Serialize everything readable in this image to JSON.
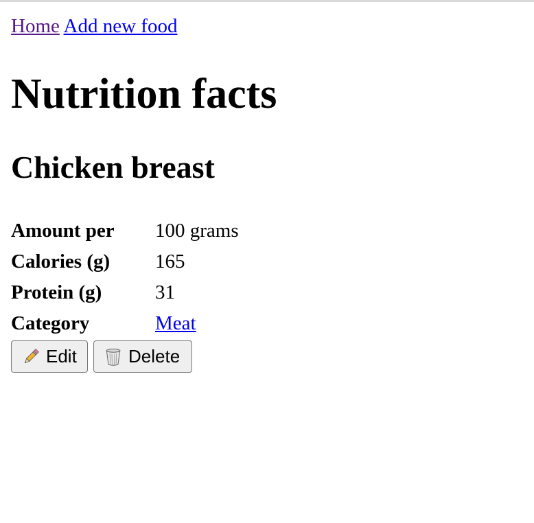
{
  "nav": {
    "home_label": "Home",
    "add_label": "Add new food"
  },
  "page": {
    "title": "Nutrition facts",
    "food_name": "Chicken breast"
  },
  "facts": {
    "rows": [
      {
        "label": "Amount per",
        "value": "100 grams"
      },
      {
        "label": "Calories (g)",
        "value": "165"
      },
      {
        "label": "Protein (g)",
        "value": "31"
      },
      {
        "label": "Category",
        "value": "Meat"
      }
    ]
  },
  "actions": {
    "edit_label": "Edit",
    "delete_label": "Delete",
    "edit_icon": "pencil-icon",
    "delete_icon": "wastebasket-icon"
  },
  "colors": {
    "link": "#0000ee",
    "visited_link": "#551a8b",
    "button_bg": "#efefef",
    "button_border": "#767676"
  }
}
